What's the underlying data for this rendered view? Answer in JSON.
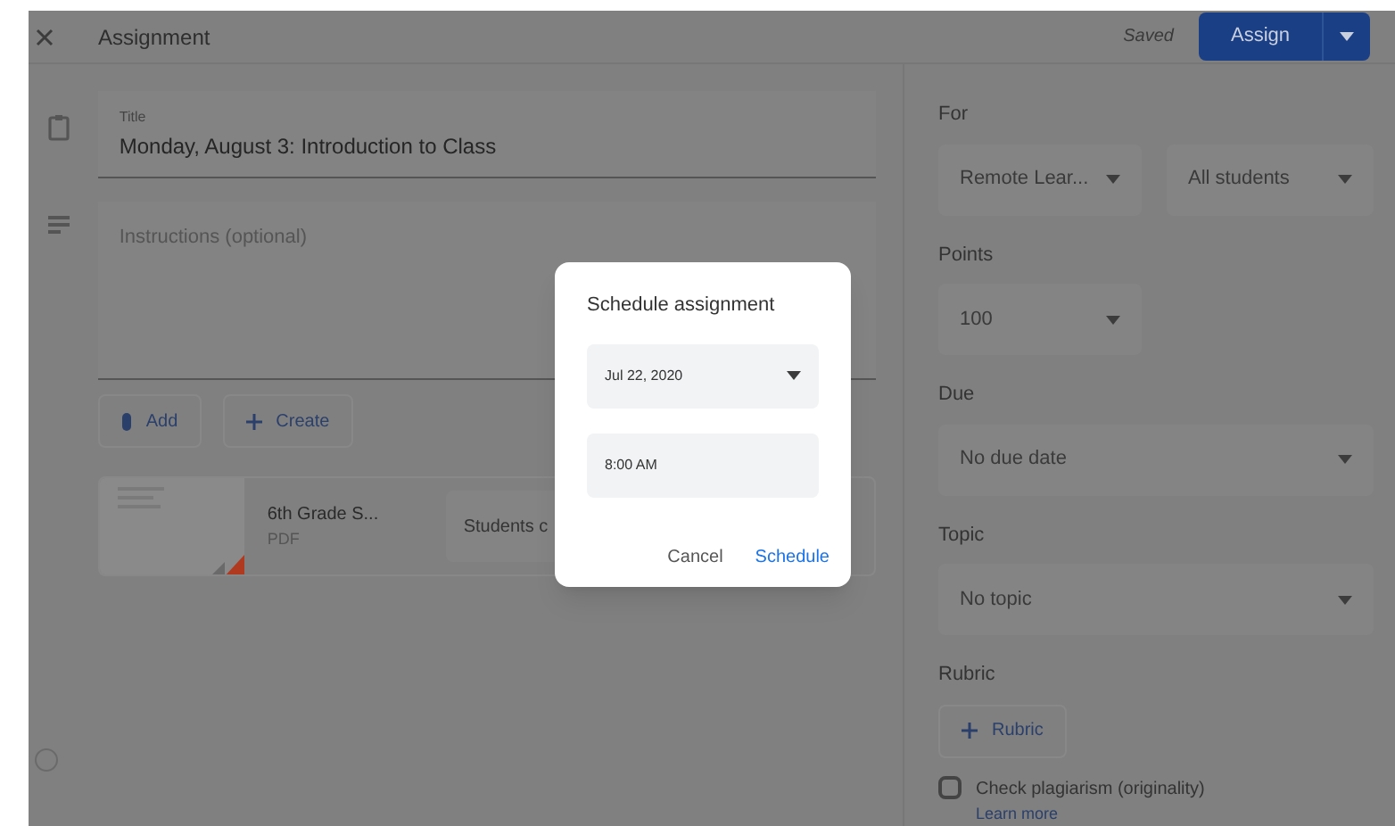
{
  "header": {
    "title": "Assignment",
    "save_status": "Saved",
    "assign_button": "Assign"
  },
  "form": {
    "title_label": "Title",
    "title_value": "Monday, August 3: Introduction to Class",
    "instructions_placeholder": "Instructions (optional)",
    "actions": [
      "Add",
      "Create"
    ],
    "attachment": {
      "name": "6th Grade S...",
      "type": "PDF",
      "access": "Students c"
    }
  },
  "settings": {
    "for_label": "For",
    "class": "Remote Lear...",
    "students": "All students",
    "points_label": "Points",
    "points": "100",
    "due_label": "Due",
    "due": "No due date",
    "topic_label": "Topic",
    "topic": "No topic",
    "rubric_label": "Rubric",
    "rubric_button": "Rubric",
    "plagiarism": {
      "label": "Check plagiarism (originality)",
      "link": "Learn more",
      "checked": false
    }
  },
  "dialog": {
    "title": "Schedule assignment",
    "date": "Jul 22, 2020",
    "time": "8:00 AM",
    "buttons": [
      "Cancel",
      "Schedule"
    ]
  }
}
